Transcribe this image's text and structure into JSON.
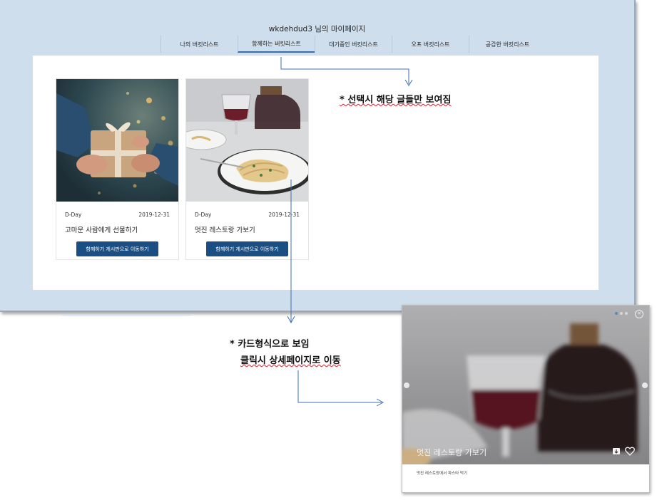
{
  "header": {
    "username": "wkdehdud3",
    "suffix": " 님의 마이페이지"
  },
  "tabs": [
    {
      "label": "나의 버킷리스트"
    },
    {
      "label": "함께하는 버킷리스트"
    },
    {
      "label": "대기중인 버킷리스트"
    },
    {
      "label": "오프 버킷리스트"
    },
    {
      "label": "공감한 버킷리스트"
    }
  ],
  "active_tab_index": 1,
  "cards": [
    {
      "dday": "D-Day",
      "date": "2019-12-31",
      "title": "고마운 사람에게 선물하기",
      "button": "함께하기 게시판으로 이동하기"
    },
    {
      "dday": "D-Day",
      "date": "2019-12-31",
      "title": "멋진 레스토랑 가보기",
      "button": "함께하기 게시판으로 이동하기"
    }
  ],
  "annotations": {
    "tab_note": "* 선택시 해당 글들만 보여짐",
    "card_note_line1": "* 카드형식으로 보임",
    "card_note_line2": "클릭시 상세페이지로 이동"
  },
  "detail": {
    "title": "멋진 레스토랑 가보기",
    "description": "멋진 레스토랑에서 파스타 먹기"
  },
  "colors": {
    "page_bg": "#cfdeec",
    "button": "#1b4f84",
    "active_tab_underline": "#3a6fa9",
    "arrow": "#3d6fb0"
  }
}
